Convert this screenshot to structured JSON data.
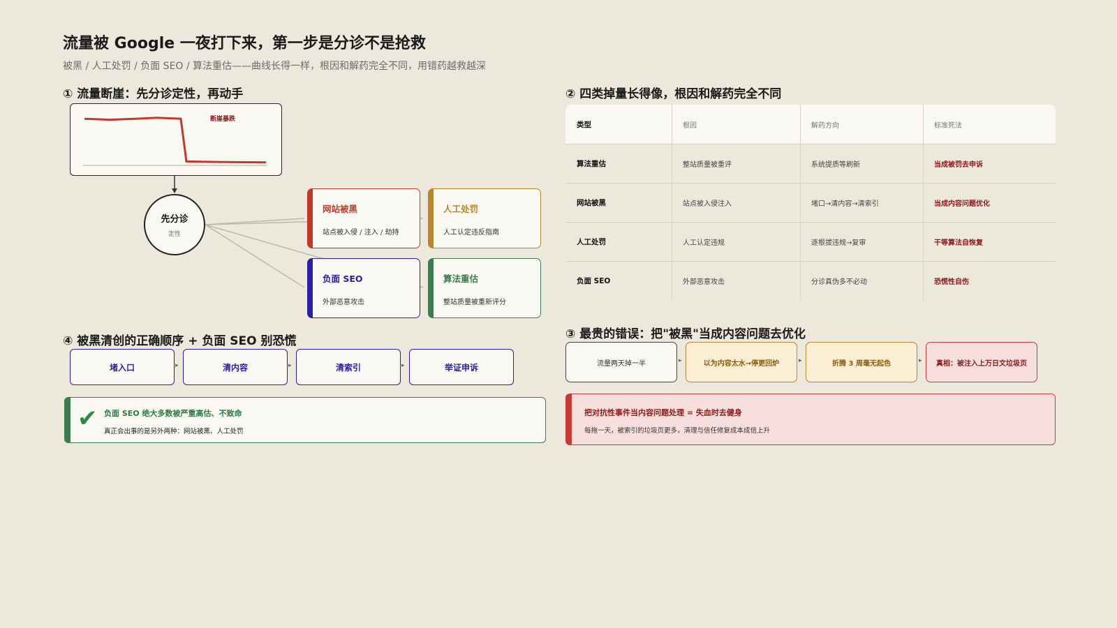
{
  "header": {
    "title": "流量被 Google 一夜打下来，第一步是分诊不是抢救",
    "subtitle": "被黑 / 人工处罚 / 负面 SEO / 算法重估——曲线长得一样，根因和解药完全不同，用错药越救越深"
  },
  "section1": {
    "heading": "① 流量断崖：先分诊定性，再动手",
    "chart_label": "断崖暴跌",
    "circle_title": "先分诊",
    "circle_sub": "定性",
    "categories": [
      {
        "name": "网站被黑",
        "desc": "站点被入侵 / 注入 / 劫持",
        "color": "#c0392b"
      },
      {
        "name": "人工处罚",
        "desc": "人工认定违反指南",
        "color": "#b8862a"
      },
      {
        "name": "负面 SEO",
        "desc": "外部恶意攻击",
        "color": "#2a1fa0"
      },
      {
        "name": "算法重估",
        "desc": "整站质量被重新评分",
        "color": "#3d7a4e"
      }
    ]
  },
  "section2": {
    "heading": "② 四类掉量长得像，根因和解药完全不同",
    "columns": [
      "类型",
      "根因",
      "解药方向",
      "标准死法"
    ],
    "rows": [
      [
        "算法重估",
        "整站质量被重评",
        "系统提质等刷新",
        "当成被罚去申诉"
      ],
      [
        "网站被黑",
        "站点被入侵注入",
        "堵口→清内容→清索引",
        "当成内容问题优化"
      ],
      [
        "人工处罚",
        "人工认定违规",
        "逐根拔违规→复审",
        "干等算法自恢复"
      ],
      [
        "负面 SEO",
        "外部恶意攻击",
        "分诊真伪多不必动",
        "恐慌性自伤"
      ]
    ]
  },
  "section3": {
    "heading": "③ 最贵的错误：把\"被黑\"当成内容问题去优化",
    "steps": [
      "流量两天掉一半",
      "以为内容太水→停更回炉",
      "折腾 3 周毫无起色",
      "真相：被注入上万日文垃圾页"
    ],
    "note_title": "把对抗性事件当内容问题处理 = 失血时去健身",
    "note_body": "每拖一天，被索引的垃圾页更多，清理与信任修复成本成倍上升"
  },
  "section4": {
    "heading": "④ 被黑清创的正确顺序 + 负面 SEO 别恐慌",
    "steps": [
      "堵入口",
      "清内容",
      "清索引",
      "举证申诉"
    ],
    "note_title": "负面 SEO 绝大多数被严重高估、不致命",
    "note_body": "真正会出事的是另外两种：网站被黑、人工处罚"
  },
  "chart_data": {
    "type": "line",
    "title": "",
    "series": [
      {
        "values": [
          0.9,
          0.88,
          0.9,
          0.92,
          0.9,
          0.05,
          0.04,
          0.03
        ]
      }
    ],
    "ylim": [
      0,
      1
    ],
    "annotation": "断崖暴跌"
  }
}
